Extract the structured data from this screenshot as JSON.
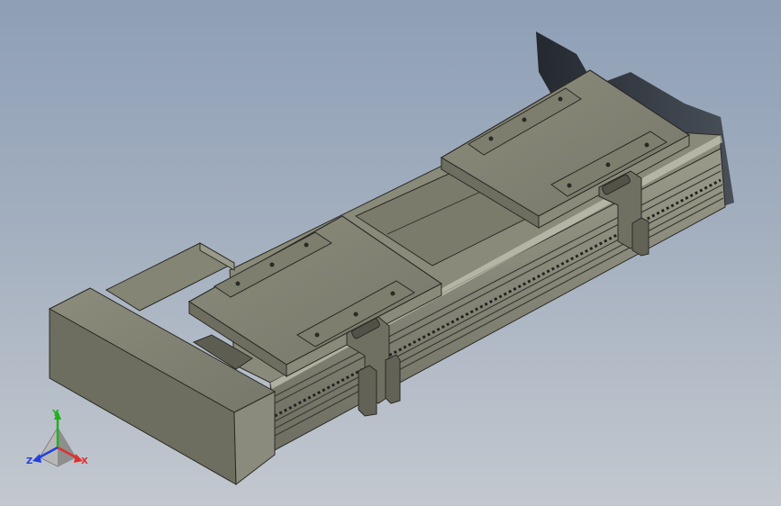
{
  "viewport": {
    "background_top": "#8e9fb6",
    "background_bottom": "#c3c8cf"
  },
  "model": {
    "body_color": "#7f7f6e",
    "carriage_count": 2,
    "icon": "linear-actuator-module"
  },
  "triad": {
    "x_label": "X",
    "y_label": "Y",
    "z_label": "Z",
    "x_color": "#e03030",
    "y_color": "#20b020",
    "z_color": "#2040e0"
  }
}
